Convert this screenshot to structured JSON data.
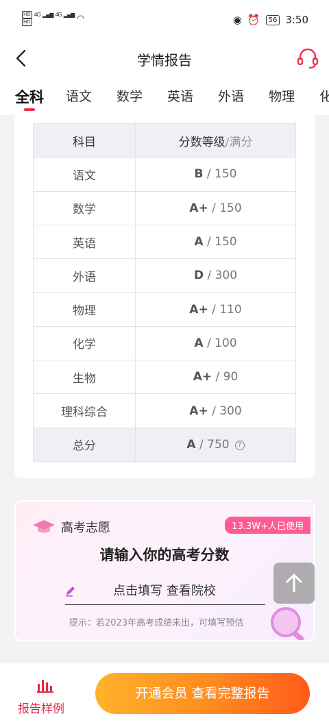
{
  "status": {
    "hd1": "HD",
    "hd2": "HD",
    "net": "4G",
    "battery": "56",
    "time": "3:50"
  },
  "header": {
    "title": "学情报告"
  },
  "tabs": [
    "全科",
    "语文",
    "数学",
    "英语",
    "外语",
    "物理",
    "化"
  ],
  "table": {
    "col_subject": "科目",
    "col_score": "分数等级",
    "col_full": "/满分",
    "rows": [
      {
        "subject": "语文",
        "grade": "B",
        "full": " / 150"
      },
      {
        "subject": "数学",
        "grade": "A+",
        "full": " / 150"
      },
      {
        "subject": "英语",
        "grade": "A",
        "full": " / 150"
      },
      {
        "subject": "外语",
        "grade": "D",
        "full": " / 300"
      },
      {
        "subject": "物理",
        "grade": "A+",
        "full": " / 110"
      },
      {
        "subject": "化学",
        "grade": "A",
        "full": " / 100"
      },
      {
        "subject": "生物",
        "grade": "A+",
        "full": " / 90"
      },
      {
        "subject": "理科综合",
        "grade": "A+",
        "full": " / 300"
      }
    ],
    "total": {
      "subject": "总分",
      "grade": "A",
      "full": " / 750"
    }
  },
  "promo": {
    "label": "高考志愿",
    "badge": "13.3W+人已使用",
    "title": "请输入你的高考分数",
    "fill_link": "点击填写 查看院校",
    "hint": "提示：若2023年高考成绩未出，可填写预估"
  },
  "bottom": {
    "sample_label": "报告样例",
    "cta": "开通会员 查看完整报告"
  },
  "colors": {
    "accent": "#f0304a",
    "cta_start": "#ffb22c",
    "cta_end": "#ff5a1a",
    "badge": "#ff5b93"
  }
}
